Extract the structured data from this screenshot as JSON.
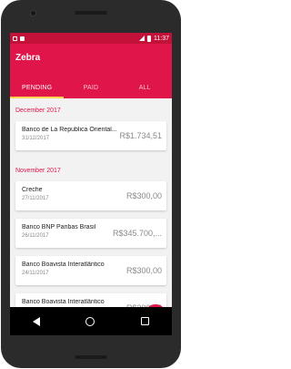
{
  "statusbar": {
    "time": "11:37"
  },
  "app": {
    "title": "Zebra"
  },
  "tabs": [
    {
      "label": "PENDING"
    },
    {
      "label": "PAID"
    },
    {
      "label": "ALL"
    }
  ],
  "sections": [
    {
      "header": "December 2017",
      "items": [
        {
          "name": "Banco de La Republica Oriental...",
          "date": "31/12/2017",
          "amount": "R$1.734,51"
        }
      ]
    },
    {
      "header": "November 2017",
      "items": [
        {
          "name": "Creche",
          "date": "27/11/2017",
          "amount": "R$300,00"
        },
        {
          "name": "Banco BNP Paribas Brasil",
          "date": "26/11/2017",
          "amount": "R$345.700,..."
        },
        {
          "name": "Banco Boavista Interatlântico",
          "date": "24/11/2017",
          "amount": "R$300,00"
        },
        {
          "name": "Banco Boavista Interatlântico",
          "date": "",
          "amount": "R$300,00"
        }
      ]
    }
  ],
  "fab": {
    "icon": "add-icon",
    "symbol": "+"
  },
  "colors": {
    "primary": "#e0154a",
    "statusbar": "#c2123a",
    "indicator": "#ffd54f"
  }
}
